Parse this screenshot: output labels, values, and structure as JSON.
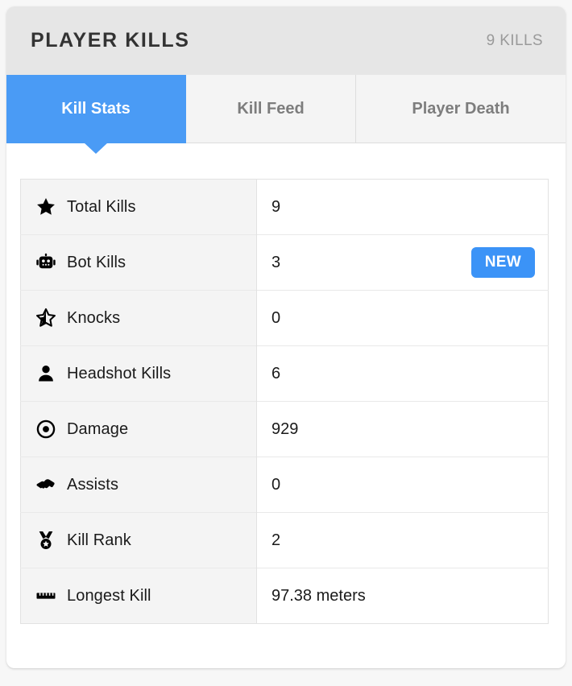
{
  "header": {
    "title": "PLAYER KILLS",
    "count_label": "9 KILLS"
  },
  "tabs": [
    {
      "label": "Kill Stats",
      "active": true
    },
    {
      "label": "Kill Feed",
      "active": false
    },
    {
      "label": "Player Death",
      "active": false
    }
  ],
  "stats": [
    {
      "icon": "star-icon",
      "label": "Total Kills",
      "value": "9",
      "badge": ""
    },
    {
      "icon": "robot-icon",
      "label": "Bot Kills",
      "value": "3",
      "badge": "NEW"
    },
    {
      "icon": "star-half-icon",
      "label": "Knocks",
      "value": "0",
      "badge": ""
    },
    {
      "icon": "person-icon",
      "label": "Headshot Kills",
      "value": "6",
      "badge": ""
    },
    {
      "icon": "bullseye-icon",
      "label": "Damage",
      "value": "929",
      "badge": ""
    },
    {
      "icon": "handshake-icon",
      "label": "Assists",
      "value": "0",
      "badge": ""
    },
    {
      "icon": "medal-icon",
      "label": "Kill Rank",
      "value": "2",
      "badge": ""
    },
    {
      "icon": "ruler-icon",
      "label": "Longest Kill",
      "value": "97.38 meters",
      "badge": ""
    }
  ],
  "colors": {
    "accent": "#4a9bf5",
    "badge": "#3b93f7",
    "header_bg": "#e6e6e6",
    "tab_bg": "#f4f4f4",
    "label_cell_bg": "#f4f4f4"
  }
}
